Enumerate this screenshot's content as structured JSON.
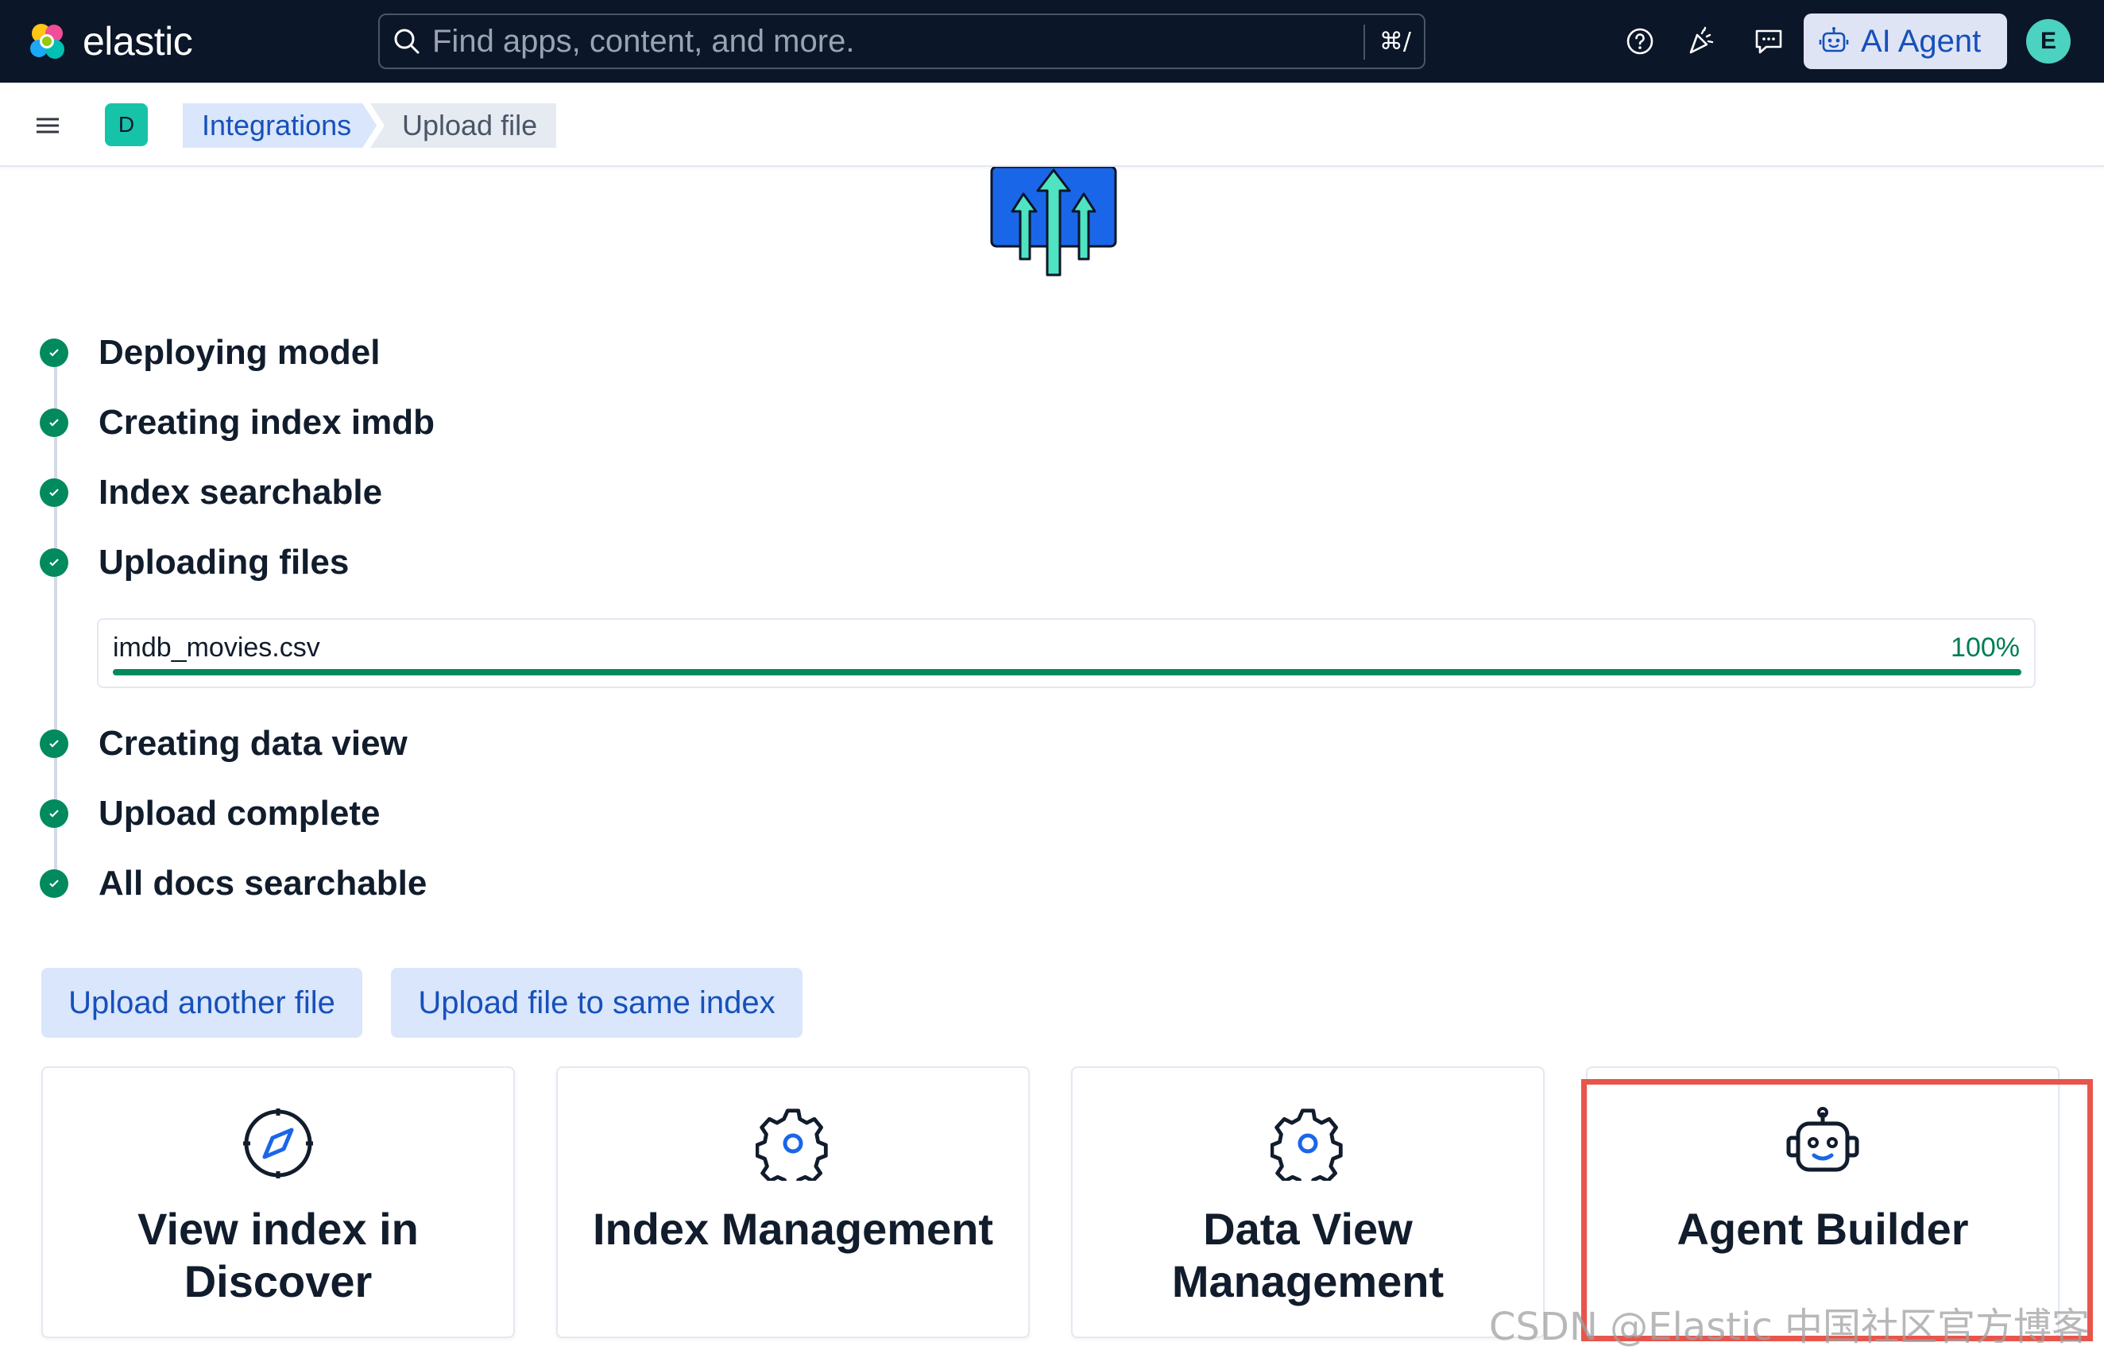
{
  "header": {
    "logo_text": "elastic",
    "search_placeholder": "Find apps, content, and more.",
    "search_shortcut": "⌘/",
    "ai_button_label": "AI Agent",
    "avatar_initial": "E",
    "icons": [
      "help-icon",
      "newsfeed-icon",
      "feedback-icon",
      "robot-icon"
    ]
  },
  "subheader": {
    "space_initial": "D",
    "breadcrumbs": [
      "Integrations",
      "Upload file"
    ]
  },
  "steps": [
    {
      "label": "Deploying model",
      "status": "complete"
    },
    {
      "label": "Creating index imdb",
      "status": "complete"
    },
    {
      "label": "Index searchable",
      "status": "complete"
    },
    {
      "label": "Uploading files",
      "status": "complete"
    },
    {
      "label": "Creating data view",
      "status": "complete"
    },
    {
      "label": "Upload complete",
      "status": "complete"
    },
    {
      "label": "All docs searchable",
      "status": "complete"
    }
  ],
  "file_progress": {
    "file_name": "imdb_movies.csv",
    "percent_label": "100%",
    "progress_fraction": 1.0
  },
  "actions": {
    "upload_another": "Upload another file",
    "upload_same_index": "Upload file to same index"
  },
  "cards": [
    {
      "title": "View index in Discover",
      "icon": "compass-icon"
    },
    {
      "title": "Index Management",
      "icon": "gear-icon"
    },
    {
      "title": "Data View Management",
      "icon": "gear-icon"
    },
    {
      "title": "Agent Builder",
      "icon": "robot-icon"
    }
  ],
  "watermark": "CSDN @Elastic 中国社区官方博客",
  "colors": {
    "header_bg": "#0b1628",
    "primary": "#1750ba",
    "success": "#008a5e",
    "highlight_border": "#e8554b"
  }
}
